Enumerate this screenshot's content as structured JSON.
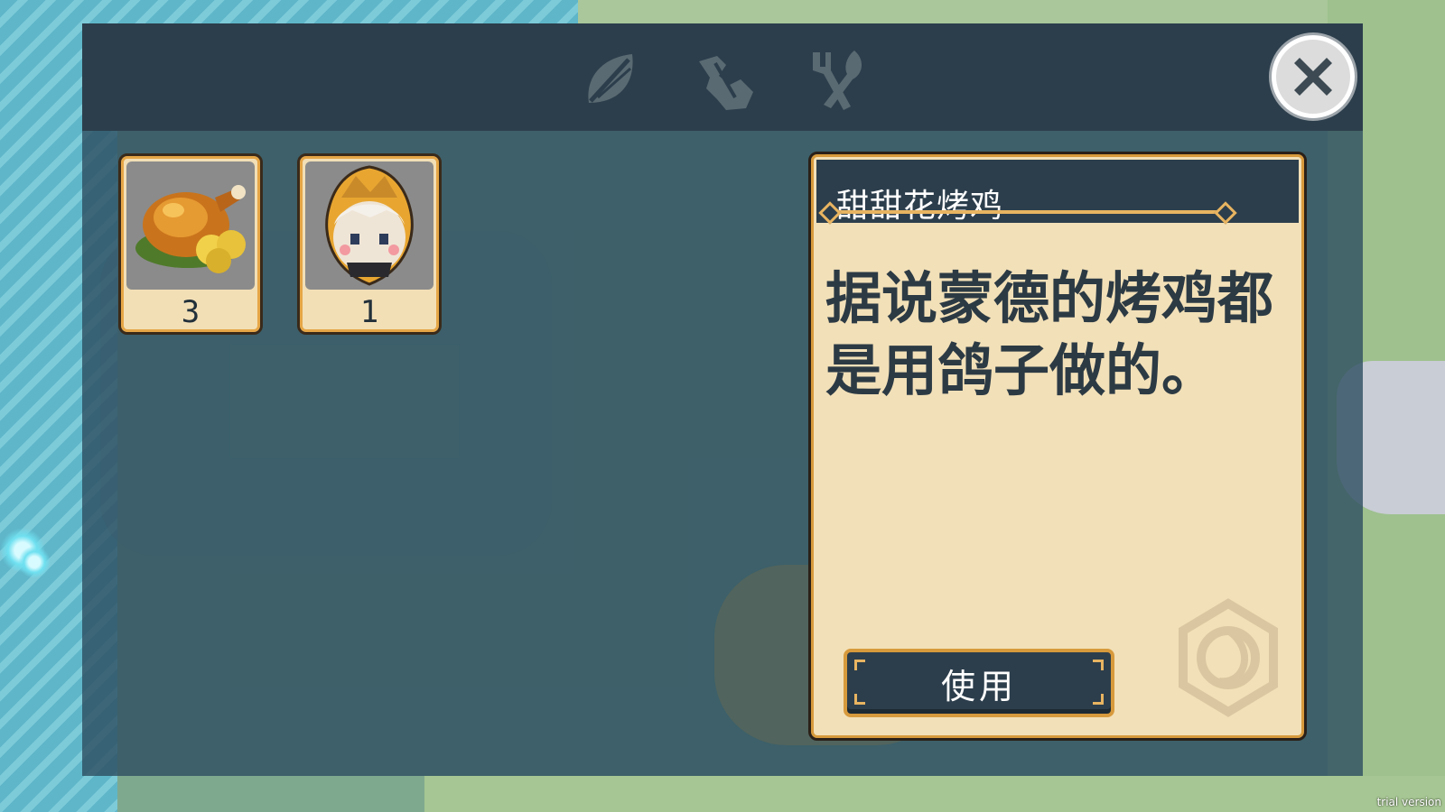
{
  "tabs": [
    {
      "name": "ingredients",
      "icon": "leaf-icon"
    },
    {
      "name": "materials",
      "icon": "herb-icon"
    },
    {
      "name": "dishes",
      "icon": "fork-knife-icon"
    }
  ],
  "close": {
    "icon": "close-icon"
  },
  "items": [
    {
      "name": "roast-chicken",
      "icon": "roast-chicken-icon",
      "count": "3"
    },
    {
      "name": "character-token",
      "icon": "character-portrait-icon",
      "count": "1"
    }
  ],
  "detail": {
    "title": "甜甜花烤鸡",
    "description": "据说蒙德的烤鸡都是用鸽子做的。",
    "use_label": "使用"
  },
  "watermark": "trial version",
  "colors": {
    "panel": "#2c3e4c",
    "card": "#f2e0b8",
    "accent": "#d79a3c"
  }
}
